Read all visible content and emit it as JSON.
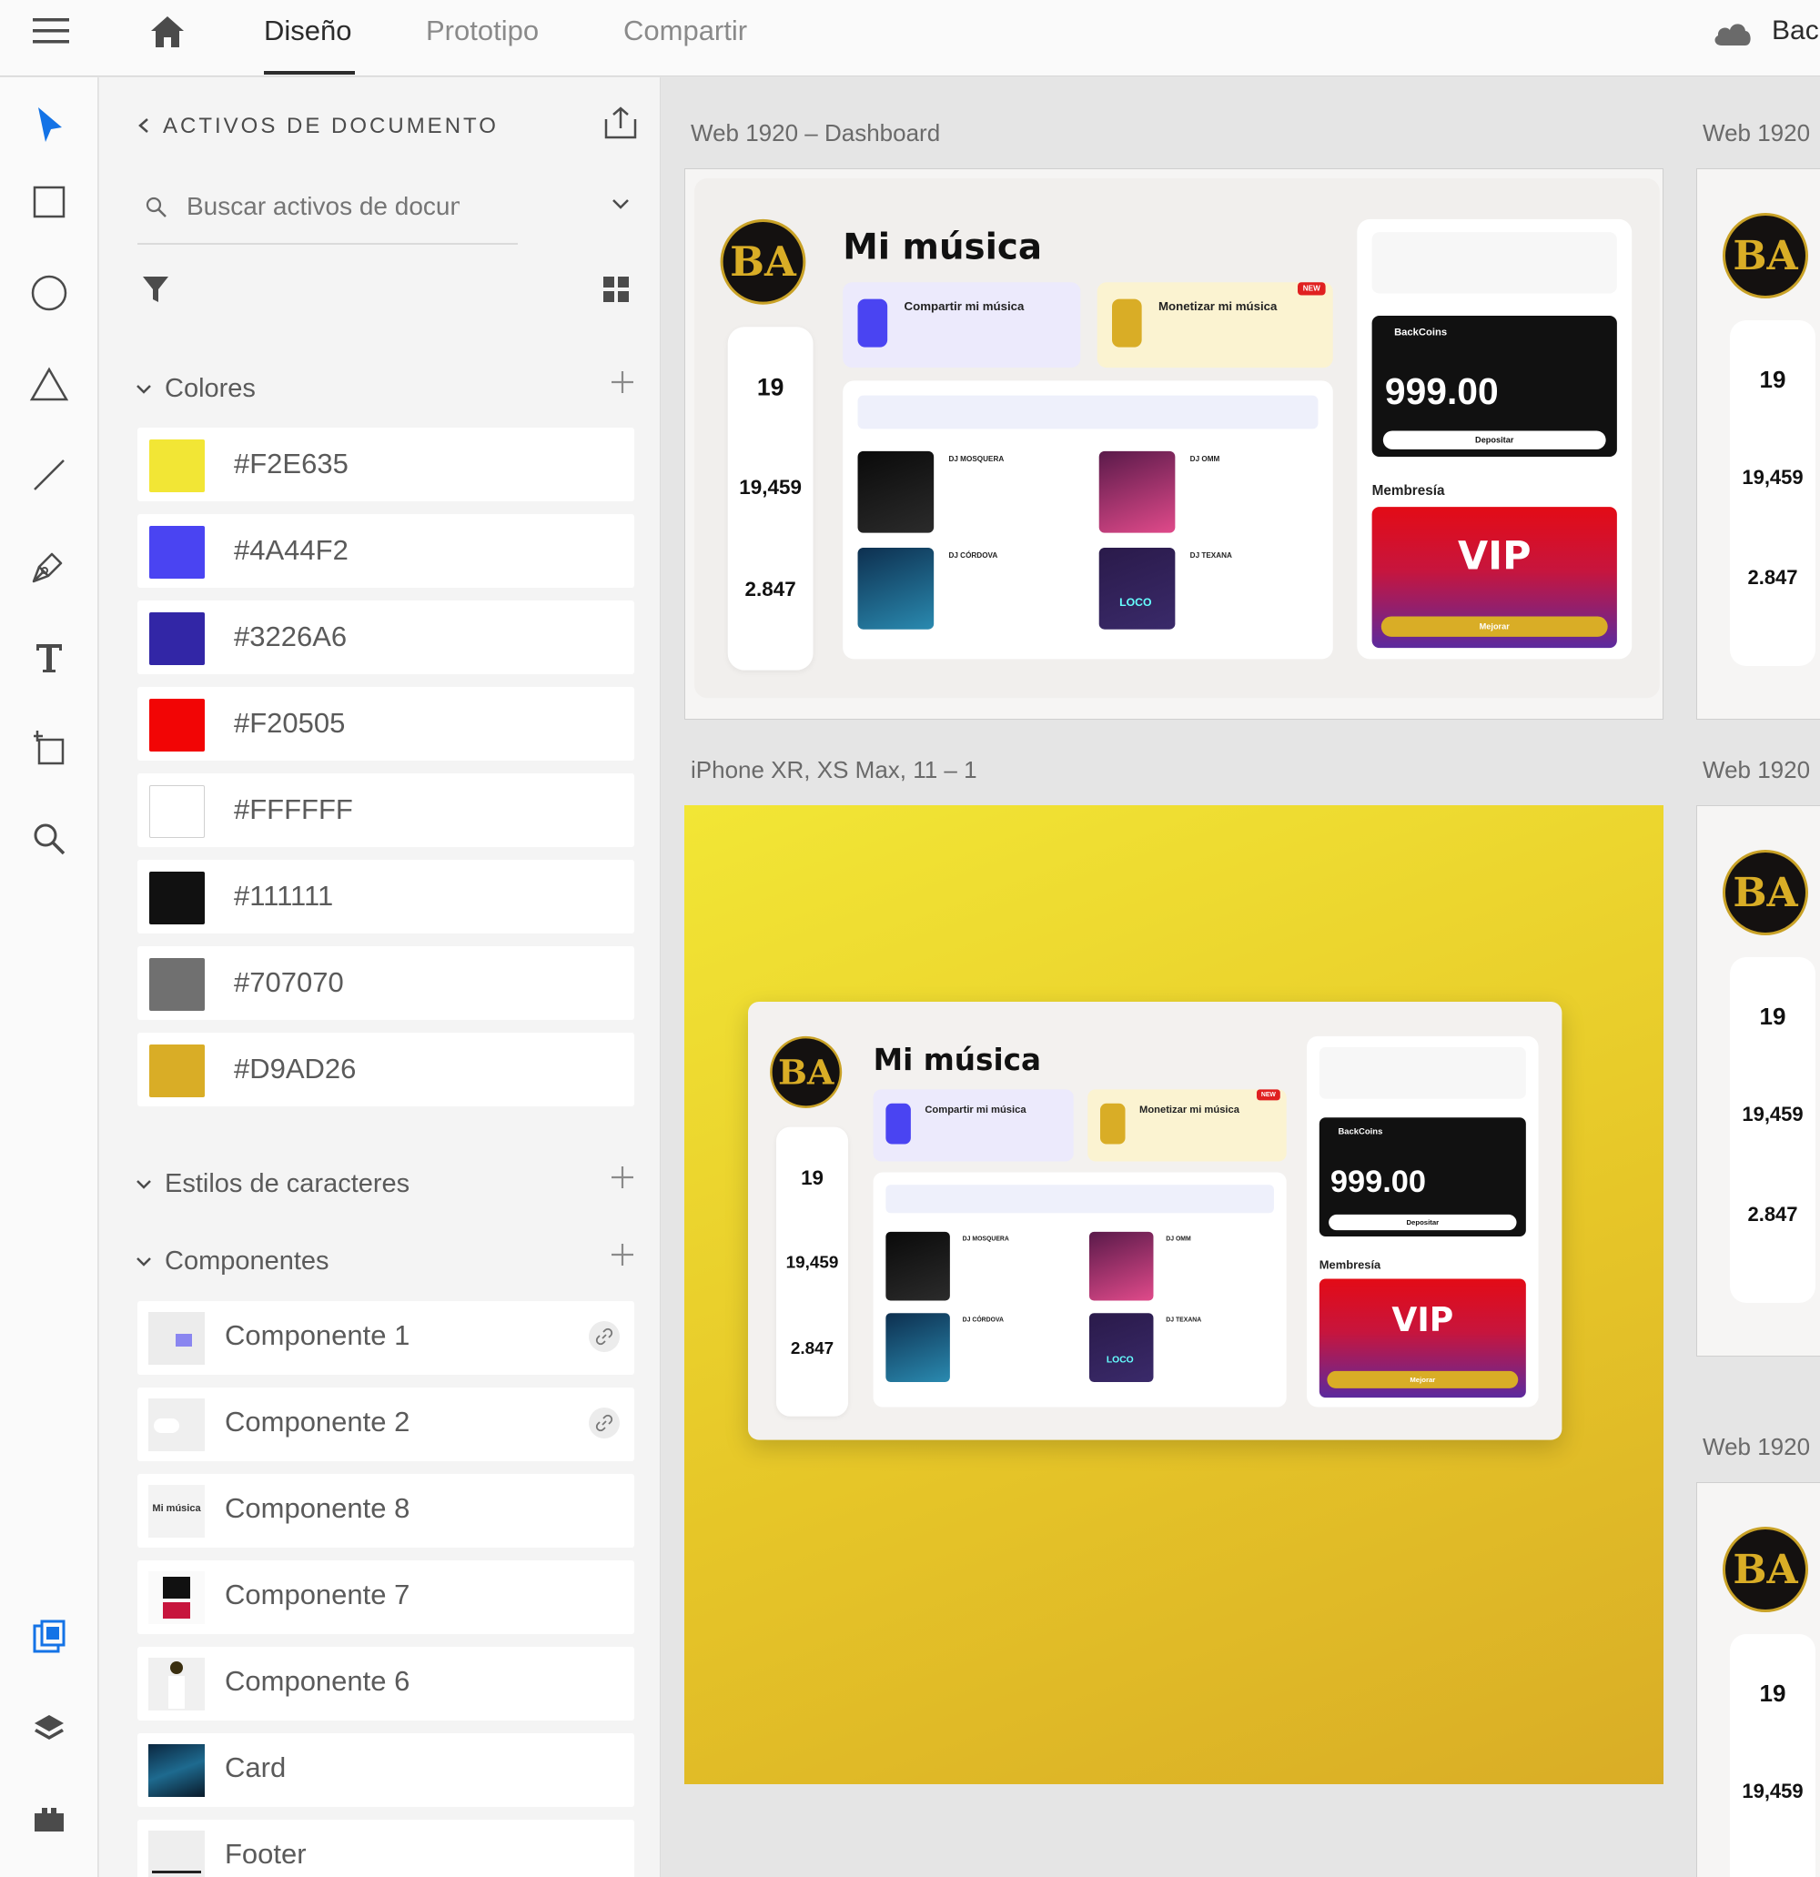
{
  "topbar": {
    "tabs": [
      "Diseño",
      "Prototipo",
      "Compartir"
    ],
    "cloud_label": "Back"
  },
  "panel": {
    "title": "ACTIVOS DE DOCUMENTO",
    "search_placeholder": "Buscar activos de docume",
    "colors_section": "Colores",
    "char_styles_section": "Estilos de caracteres",
    "components_section": "Componentes",
    "colors": [
      {
        "hex": "#F2E635",
        "label": "#F2E635"
      },
      {
        "hex": "#4A44F2",
        "label": "#4A44F2"
      },
      {
        "hex": "#3226A6",
        "label": "#3226A6"
      },
      {
        "hex": "#F20505",
        "label": "#F20505"
      },
      {
        "hex": "#FFFFFF",
        "label": "#FFFFFF"
      },
      {
        "hex": "#111111",
        "label": "#111111"
      },
      {
        "hex": "#707070",
        "label": "#707070"
      },
      {
        "hex": "#D9AD26",
        "label": "#D9AD26"
      }
    ],
    "components": [
      {
        "label": "Componente 1",
        "linked": true
      },
      {
        "label": "Componente 2",
        "linked": true
      },
      {
        "label": "Componente 8",
        "linked": false,
        "thumb_text": "Mi música"
      },
      {
        "label": "Componente 7",
        "linked": false
      },
      {
        "label": "Componente 6",
        "linked": false
      },
      {
        "label": "Card",
        "linked": false
      },
      {
        "label": "Footer",
        "linked": false
      }
    ]
  },
  "canvas": {
    "artboards": [
      {
        "label": "Web 1920 – Dashboard"
      },
      {
        "label": "Web 1920"
      },
      {
        "label": "iPhone XR, XS Max, 11 – 1"
      },
      {
        "label": "Web 1920"
      },
      {
        "label": "Web 1920"
      }
    ]
  },
  "dashboard": {
    "logo": "BA",
    "title": "Mi música",
    "stats": [
      {
        "num": "19"
      },
      {
        "num": "19,459"
      },
      {
        "num": "2.847"
      }
    ],
    "share_card": {
      "title": "Compartir mi música"
    },
    "money_card": {
      "title": "Monetizar mi música",
      "badge": "NEW"
    },
    "coins": {
      "label": "BackCoins",
      "amount": "999.00",
      "button": "Depositar"
    },
    "membership": "Membresía",
    "vip": {
      "title": "VIP",
      "button": "Mejorar"
    },
    "songs": [
      {
        "title": "DJ MOSQUERA"
      },
      {
        "title": "DJ OMM"
      },
      {
        "title": "DJ CÓRDOVA"
      },
      {
        "title": "DJ TEXANA"
      }
    ],
    "cover_texts": [
      "LOCO"
    ]
  },
  "colors": {
    "accent": "#2680EB",
    "yellow_bg": "#F2E635",
    "gold": "#D9AD26",
    "purple": "#4A44F2",
    "red": "#F20505"
  }
}
